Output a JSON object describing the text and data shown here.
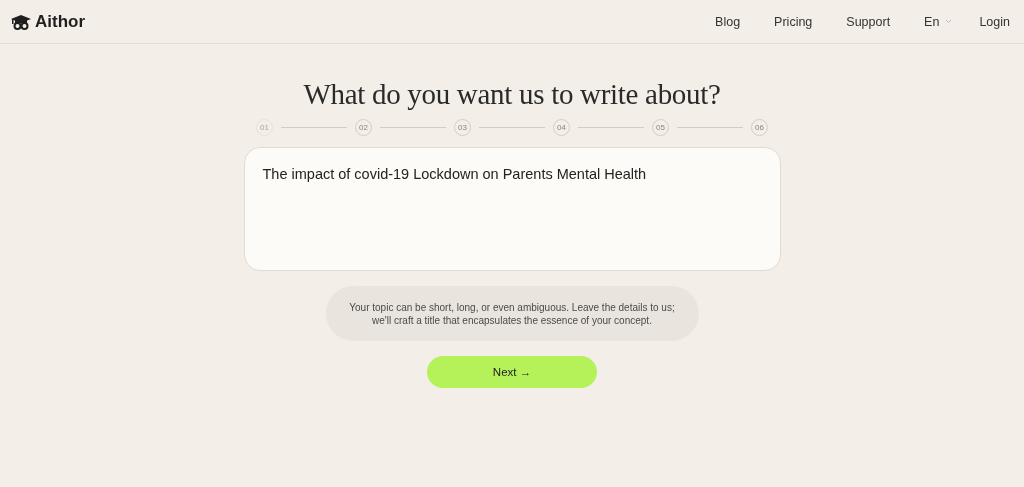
{
  "brand": {
    "name": "Aithor"
  },
  "nav": [
    {
      "label": "Blog",
      "kind": "link"
    },
    {
      "label": "Pricing",
      "kind": "link"
    },
    {
      "label": "Support",
      "kind": "link"
    },
    {
      "label": "En",
      "kind": "dropdown"
    },
    {
      "label": "Login",
      "kind": "link"
    }
  ],
  "heading": "What do you want us to write about?",
  "steps": [
    {
      "label": "01",
      "selected": true
    },
    {
      "label": "02",
      "selected": false
    },
    {
      "label": "03",
      "selected": false
    },
    {
      "label": "04",
      "selected": false
    },
    {
      "label": "05",
      "selected": false
    },
    {
      "label": "06",
      "selected": false
    }
  ],
  "topic": {
    "value": "The impact of covid-19 Lockdown on Parents Mental Health"
  },
  "hint": "Your topic can be short, long, or even ambiguous. Leave the details to us; we'll craft a title that encapsulates the essence of your concept.",
  "next_button": "Next →"
}
